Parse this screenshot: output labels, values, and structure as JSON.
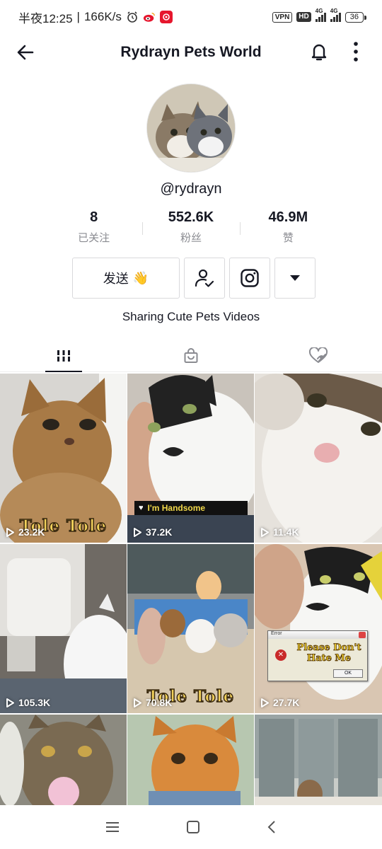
{
  "status_bar": {
    "time": "半夜12:25",
    "speed": "166K/s",
    "vpn": "VPN",
    "hd": "HD",
    "net1": "4G",
    "net2": "4G",
    "battery": "36"
  },
  "header": {
    "title": "Rydrayn Pets World"
  },
  "profile": {
    "username": "@rydrayn",
    "bio": "Sharing Cute Pets Videos",
    "stats": [
      {
        "value": "8",
        "label": "已关注"
      },
      {
        "value": "552.6K",
        "label": "粉丝"
      },
      {
        "value": "46.9M",
        "label": "赞"
      }
    ]
  },
  "actions": {
    "send_label": "发送",
    "send_emoji": "👋"
  },
  "tabs": [
    {
      "icon": "grid-icon",
      "active": true
    },
    {
      "icon": "shop-bag-icon",
      "active": false
    },
    {
      "icon": "liked-hidden-icon",
      "active": false
    }
  ],
  "videos": [
    {
      "views": "23.2K",
      "caption": "Tole Tole"
    },
    {
      "views": "37.2K",
      "caption": "I'm Handsome"
    },
    {
      "views": "11.4K"
    },
    {
      "views": "105.3K"
    },
    {
      "views": "70.8K",
      "caption": "Tole Tole"
    },
    {
      "views": "27.7K",
      "dialog_title": "Error",
      "dialog_text": "Please Don't Hate Me",
      "dialog_ok": "OK"
    },
    {
      "views": ""
    },
    {
      "views": ""
    },
    {
      "views": ""
    }
  ]
}
